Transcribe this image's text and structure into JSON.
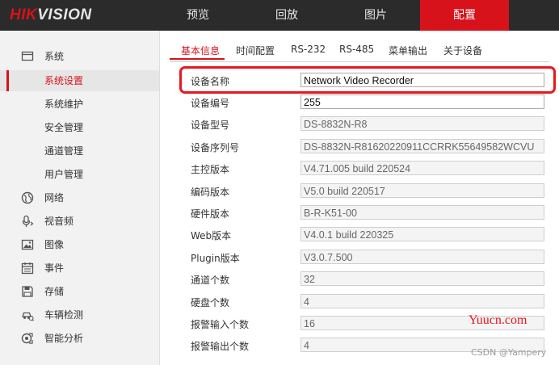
{
  "brand": {
    "prefix": "HIK",
    "suffix": "VISION",
    "accent_color": "#d7121b"
  },
  "nav": [
    {
      "label": "预览"
    },
    {
      "label": "回放"
    },
    {
      "label": "图片"
    },
    {
      "label": "配置",
      "active": true
    }
  ],
  "sidebar": {
    "items": [
      {
        "label": "系统",
        "icon": "monitor-icon"
      },
      {
        "label": "系统设置",
        "active": true
      },
      {
        "label": "系统维护"
      },
      {
        "label": "安全管理"
      },
      {
        "label": "通道管理"
      },
      {
        "label": "用户管理"
      },
      {
        "label": "网络",
        "icon": "globe-icon"
      },
      {
        "label": "视音频",
        "icon": "microphone-icon"
      },
      {
        "label": "图像",
        "icon": "image-icon"
      },
      {
        "label": "事件",
        "icon": "calendar-icon"
      },
      {
        "label": "存储",
        "icon": "floppy-disk-icon"
      },
      {
        "label": "车辆检测",
        "icon": "car-icon"
      },
      {
        "label": "智能分析",
        "icon": "analytics-icon"
      }
    ]
  },
  "tabs": [
    {
      "label": "基本信息",
      "active": true
    },
    {
      "label": "时间配置"
    },
    {
      "label": "RS-232"
    },
    {
      "label": "RS-485"
    },
    {
      "label": "菜单输出"
    },
    {
      "label": "关于设备"
    }
  ],
  "fields": [
    {
      "label": "设备名称",
      "value": "Network Video Recorder",
      "editable": true
    },
    {
      "label": "设备编号",
      "value": "255",
      "editable": true
    },
    {
      "label": "设备型号",
      "value": "DS-8832N-R8"
    },
    {
      "label": "设备序列号",
      "value": "DS-8832N-R81620220911CCRRK55649582WCVU"
    },
    {
      "label": "主控版本",
      "value": "V4.71.005 build 220524"
    },
    {
      "label": "编码版本",
      "value": "V5.0 build 220517"
    },
    {
      "label": "硬件版本",
      "value": "B-R-K51-00"
    },
    {
      "label": "Web版本",
      "value": "V4.0.1 build 220325"
    },
    {
      "label": "Plugin版本",
      "value": "V3.0.7.500"
    },
    {
      "label": "通道个数",
      "value": "32"
    },
    {
      "label": "硬盘个数",
      "value": "4"
    },
    {
      "label": "报警输入个数",
      "value": "16"
    },
    {
      "label": "报警输出个数",
      "value": "4"
    }
  ],
  "watermarks": {
    "site": "Yuucn.com",
    "author": "CSDN @Yampery"
  }
}
